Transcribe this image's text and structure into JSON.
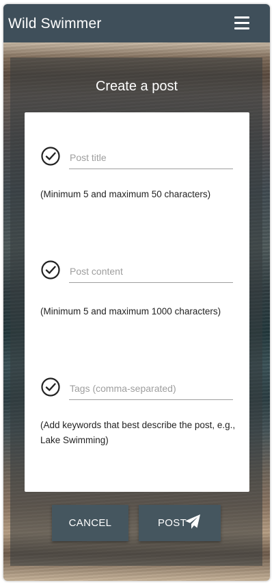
{
  "navbar": {
    "brand": "Wild Swimmer",
    "menu_icon": "hamburger-menu-icon"
  },
  "page": {
    "title": "Create a post"
  },
  "form": {
    "fields": [
      {
        "placeholder": "Post title",
        "value": "",
        "helper": "(Minimum 5 and maximum 50 characters)",
        "icon": "check-circle-icon"
      },
      {
        "placeholder": "Post content",
        "value": "",
        "helper": "(Minimum 5 and maximum 1000 characters)",
        "icon": "check-circle-icon"
      },
      {
        "placeholder": "Tags (comma-separated)",
        "value": "",
        "helper": "(Add keywords that best describe the post, e.g., Lake Swimming)",
        "icon": "check-circle-icon"
      }
    ]
  },
  "actions": {
    "cancel_label": "CANCEL",
    "post_label": "POST",
    "post_icon": "send-icon"
  },
  "colors": {
    "navbar": "#3f4f5a",
    "button": "#45565f",
    "card": "#ffffff"
  }
}
